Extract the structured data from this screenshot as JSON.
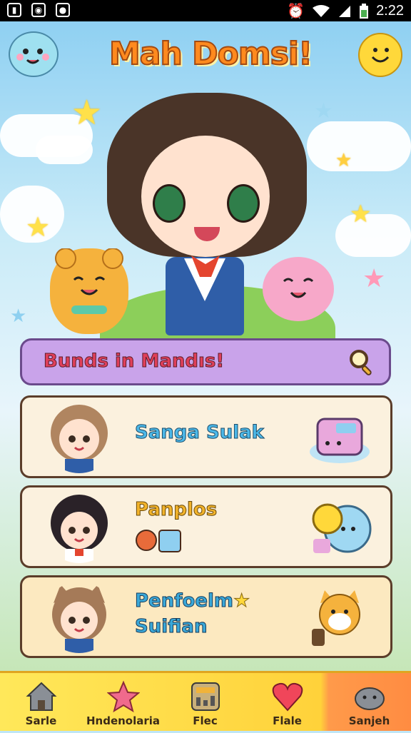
{
  "status_bar": {
    "time": "2:22"
  },
  "header": {
    "title": "Mah Domsi!"
  },
  "search": {
    "label": "Bunds in Mandıs!"
  },
  "cards": [
    {
      "title": "Sanga Sulak",
      "title_color": "#4cb8e8"
    },
    {
      "title": "Panplos",
      "title_color": "#f2b32a"
    },
    {
      "title_line1": "Penfoelm",
      "title_line2": "Suifian",
      "title_color": "#3aa8d8"
    }
  ],
  "nav": {
    "items": [
      {
        "label": "Sarle",
        "icon": "house-icon"
      },
      {
        "label": "Hndenolaria",
        "icon": "star-icon"
      },
      {
        "label": "Flec",
        "icon": "shop-icon"
      },
      {
        "label": "Flale",
        "icon": "heart-icon"
      },
      {
        "label": "Sanjeh",
        "icon": "cloud-blob-icon"
      }
    ]
  },
  "colors": {
    "title_orange": "#ff8a1e",
    "search_purple": "#c9a3ea",
    "nav_yellow": "#ffd23a",
    "nav_active_orange": "#ff8c42"
  }
}
